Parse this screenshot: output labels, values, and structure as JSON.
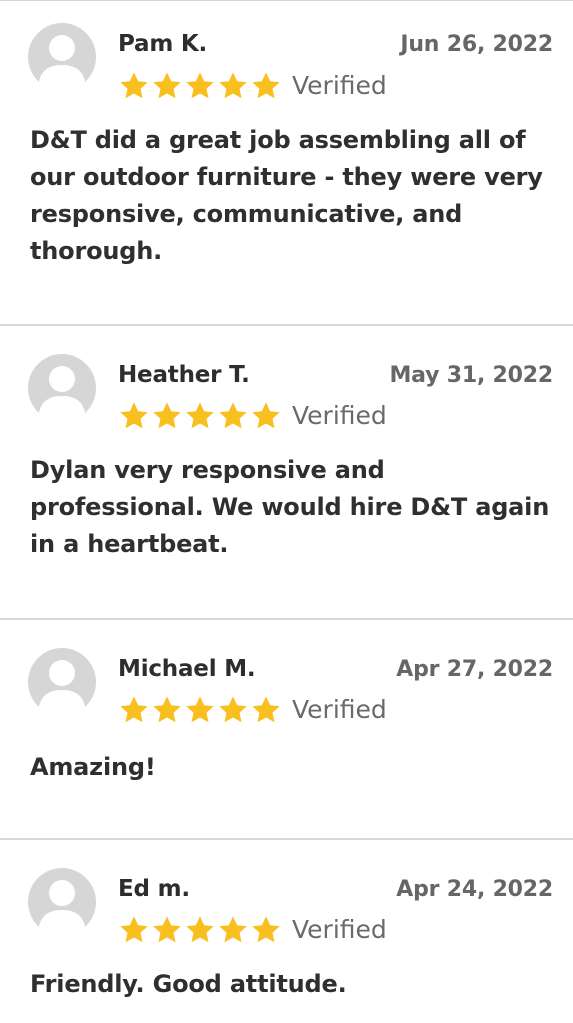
{
  "colors": {
    "star": "#F8BF1E",
    "avatar": "#D6D6D6",
    "divider": "#D9D9D9",
    "text": "#2F2F2F",
    "muted": "#666666"
  },
  "icons": {
    "avatar": "default-user-avatar-icon",
    "star": "star-icon"
  },
  "reviews": [
    {
      "name": "Pam K.",
      "date": "Jun 26, 2022",
      "rating": 5,
      "verified_label": "Verified",
      "text": "D&T did a great job assembling all of our outdoor furniture - they were very responsive, communicative, and thorough."
    },
    {
      "name": "Heather T.",
      "date": "May 31, 2022",
      "rating": 5,
      "verified_label": "Verified",
      "text": "Dylan very responsive and professional. We would hire D&T again in a heartbeat."
    },
    {
      "name": "Michael M.",
      "date": "Apr 27, 2022",
      "rating": 5,
      "verified_label": "Verified",
      "text": "Amazing!"
    },
    {
      "name": "Ed m.",
      "date": "Apr 24, 2022",
      "rating": 5,
      "verified_label": "Verified",
      "text": "Friendly. Good attitude."
    }
  ]
}
